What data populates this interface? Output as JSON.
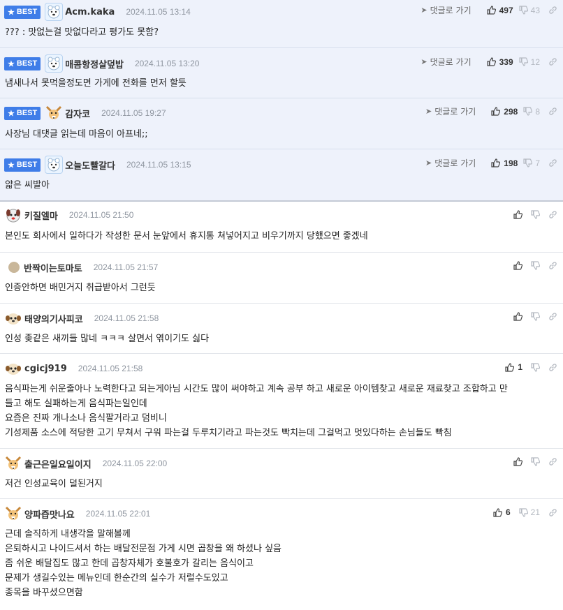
{
  "best_label": "BEST",
  "goto_label": "댓글로 가기",
  "best_comments": [
    {
      "nick": "Acm.kaka",
      "date": "2024.11.05 13:14",
      "text": "??? : 맛없는걸 맛없다라고 평가도 못함?",
      "up": "497",
      "down": "43",
      "avatar": "polar-bear"
    },
    {
      "nick": "매콤항정살덮밥",
      "date": "2024.11.05 13:20",
      "text": "냄새나서 못먹을정도면 가게에 전화를 먼저 할듯",
      "up": "339",
      "down": "12",
      "avatar": "polar-bear"
    },
    {
      "nick": "감자코",
      "date": "2024.11.05 19:27",
      "text": "사장님 대댓글 읽는데 마음이 아프네;;",
      "up": "298",
      "down": "8",
      "avatar": "fennec-fox"
    },
    {
      "nick": "오늘도빨갈다",
      "date": "2024.11.05 13:15",
      "text": "얇은 씨발아",
      "up": "198",
      "down": "7",
      "avatar": "polar-bear"
    }
  ],
  "comments": [
    {
      "nick": "키질엘마",
      "date": "2024.11.05 21:50",
      "lines": [
        "본인도 회사에서 일하다가 작성한 문서 눈앞에서 휴지통 쳐넣어지고 비우기까지 당했으면 좋겠네"
      ],
      "up": "",
      "down": "",
      "avatar": "puppy-face"
    },
    {
      "nick": "반짝이는토마토",
      "date": "2024.11.05 21:57",
      "lines": [
        "인증안하면 배민거지 취급받아서 그런듯"
      ],
      "up": "",
      "down": "",
      "avatar": "dot"
    },
    {
      "nick": "태양의기사피코",
      "date": "2024.11.05 21:58",
      "lines": [
        "인성 좆같은 새끼들 많네 ㅋㅋㅋ 살면서 엮이기도 싫다"
      ],
      "up": "",
      "down": "",
      "avatar": "dog"
    },
    {
      "nick": "cgicj919",
      "date": "2024.11.05 21:58",
      "lines": [
        "음식파는게 쉬운줄아나 노력한다고 되는게아님 시간도 많이 써야하고 계속 공부 하고 새로운 아이템찾고 새로운 재료찾고 조합하고 만",
        "들고 해도 실패하는게 음식파는일인데",
        "요즘은 진짜 개나소나 음식팔거라고 덤비니",
        "기성제품 소스에 적당한 고기 무쳐서 구워 파는걸 두루치기라고 파는것도 빡치는데 그걸먹고 멋있다하는 손님들도 빡침"
      ],
      "up": "1",
      "down": "",
      "avatar": "dog"
    },
    {
      "nick": "출근은일요일이지",
      "date": "2024.11.05 22:00",
      "lines": [
        "저건 인성교육이 덜된거지"
      ],
      "up": "",
      "down": "",
      "avatar": "fennec-fox"
    },
    {
      "nick": "양파즙맛나요",
      "date": "2024.11.05 22:01",
      "lines": [
        "근데 솔직하게 내생각을 말해볼께",
        "은퇴하시고 나이드셔서 하는 배달전문점 가게 시면 곱창을 왜 하셨나 싶음",
        "좀 쉬운 배달집도 많고 한데 곱창자체가 호불호가 갈리는 음식이고",
        "문제가 생길수있는 메뉴인데 한순간의 실수가 저럴수도있고",
        "종목을 바꾸셨으면함"
      ],
      "up": "6",
      "down": "21",
      "avatar": "fennec-fox"
    }
  ]
}
